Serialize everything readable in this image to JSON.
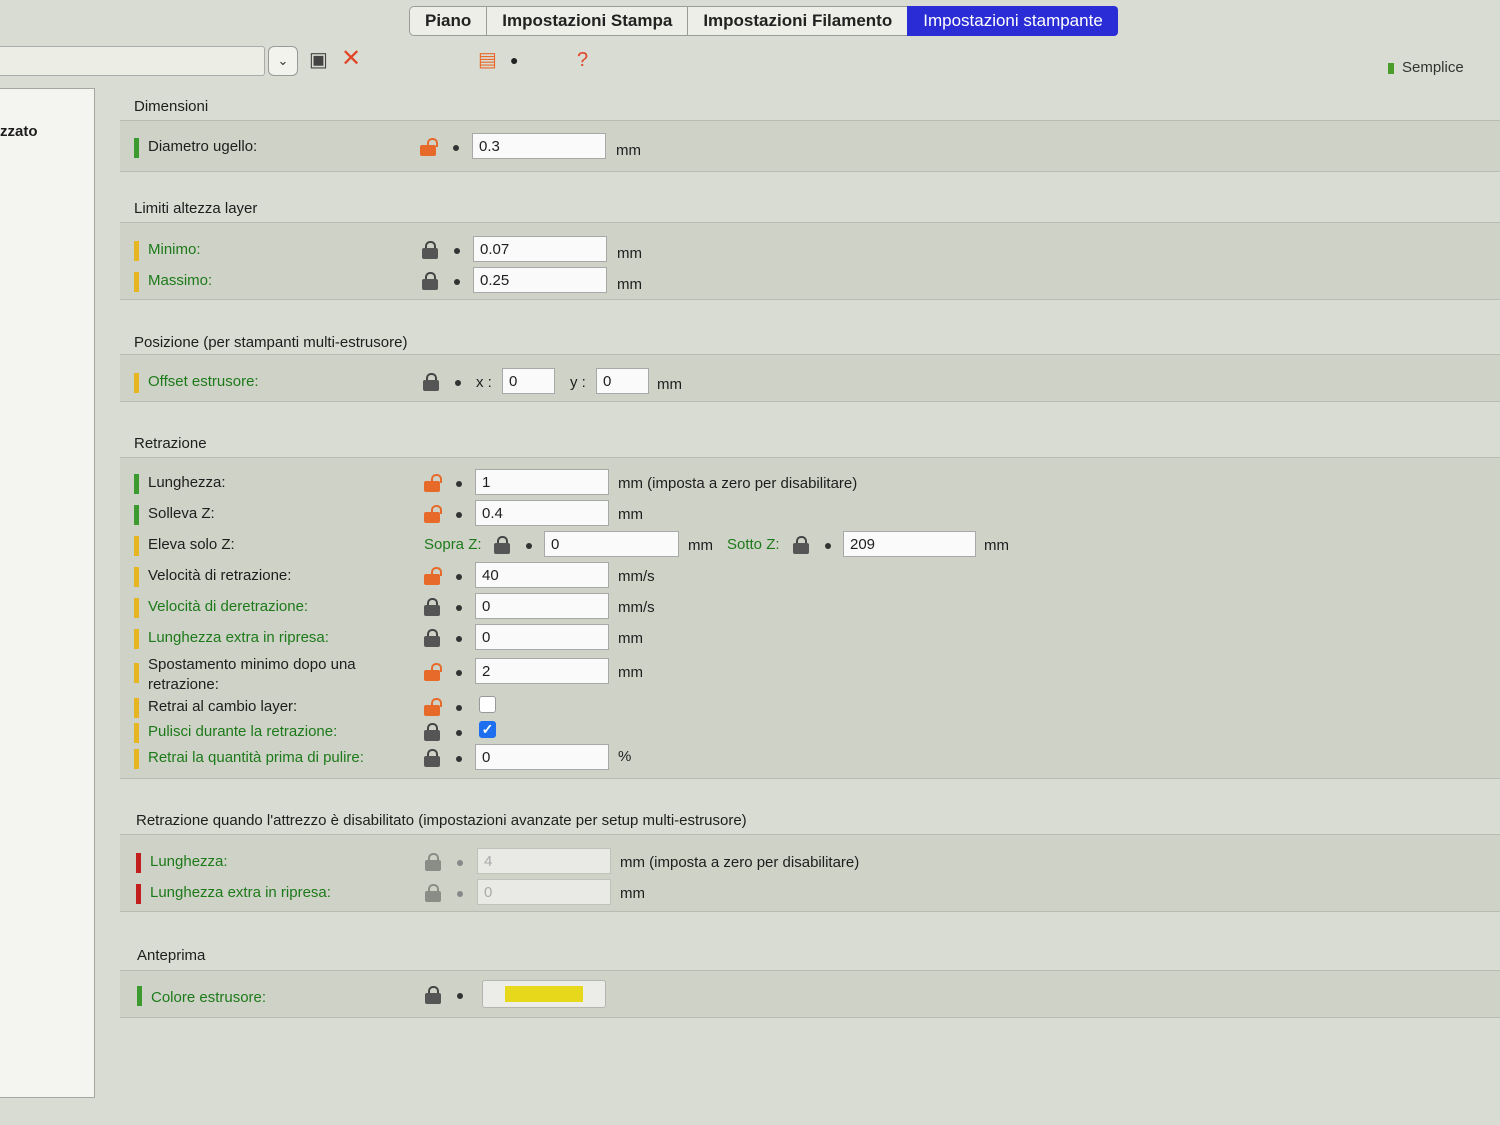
{
  "tabs": [
    {
      "label": "Piano",
      "active": false
    },
    {
      "label": "Impostazioni Stampa",
      "active": false
    },
    {
      "label": "Impostazioni Filamento",
      "active": false
    },
    {
      "label": "Impostazioni stampante",
      "active": true
    }
  ],
  "toolbar": {
    "mode_label": "Semplice"
  },
  "left_pane": {
    "partial_text": "zzato"
  },
  "sections": {
    "dimensioni": {
      "title": "Dimensioni",
      "diametro": {
        "label": "Diametro ugello:",
        "value": "0.3",
        "unit": "mm"
      }
    },
    "limiti": {
      "title": "Limiti altezza layer",
      "minimo": {
        "label": "Minimo:",
        "value": "0.07",
        "unit": "mm"
      },
      "massimo": {
        "label": "Massimo:",
        "value": "0.25",
        "unit": "mm"
      }
    },
    "posizione": {
      "title": "Posizione (per stampanti multi-estrusore)",
      "offset": {
        "label": "Offset estrusore:",
        "x_label": "x :",
        "x_value": "0",
        "y_label": "y :",
        "y_value": "0",
        "unit": "mm"
      }
    },
    "retrazione": {
      "title": "Retrazione",
      "lunghezza": {
        "label": "Lunghezza:",
        "value": "1",
        "unit": "mm (imposta a zero per disabilitare)"
      },
      "solleva": {
        "label": "Solleva Z:",
        "value": "0.4",
        "unit": "mm"
      },
      "eleva": {
        "label": "Eleva solo Z:",
        "sopra_label": "Sopra Z:",
        "sopra_value": "0",
        "sopra_unit": "mm",
        "sotto_label": "Sotto Z:",
        "sotto_value": "209",
        "sotto_unit": "mm"
      },
      "velocita": {
        "label": "Velocità di retrazione:",
        "value": "40",
        "unit": "mm/s"
      },
      "deretrazione": {
        "label": "Velocità di deretrazione:",
        "value": "0",
        "unit": "mm/s"
      },
      "extra": {
        "label": "Lunghezza extra in ripresa:",
        "value": "0",
        "unit": "mm"
      },
      "spostamento": {
        "label": "Spostamento minimo dopo una retrazione:",
        "value": "2",
        "unit": "mm"
      },
      "cambio_layer": {
        "label": "Retrai al cambio layer:",
        "checked": false
      },
      "pulisci": {
        "label": "Pulisci durante la retrazione:",
        "checked": true
      },
      "quantita": {
        "label": "Retrai la quantità prima di pulire:",
        "value": "0",
        "unit": "%"
      }
    },
    "retrazione_disab": {
      "title": "Retrazione quando l'attrezzo è disabilitato (impostazioni avanzate per setup multi-estrusore)",
      "lunghezza": {
        "label": "Lunghezza:",
        "value": "4",
        "unit": "mm (imposta a zero per disabilitare)"
      },
      "extra": {
        "label": "Lunghezza extra in ripresa:",
        "value": "0",
        "unit": "mm"
      }
    },
    "anteprima": {
      "title": "Anteprima",
      "colore": {
        "label": "Colore estrusore:",
        "color": "#e8d81c"
      }
    }
  }
}
